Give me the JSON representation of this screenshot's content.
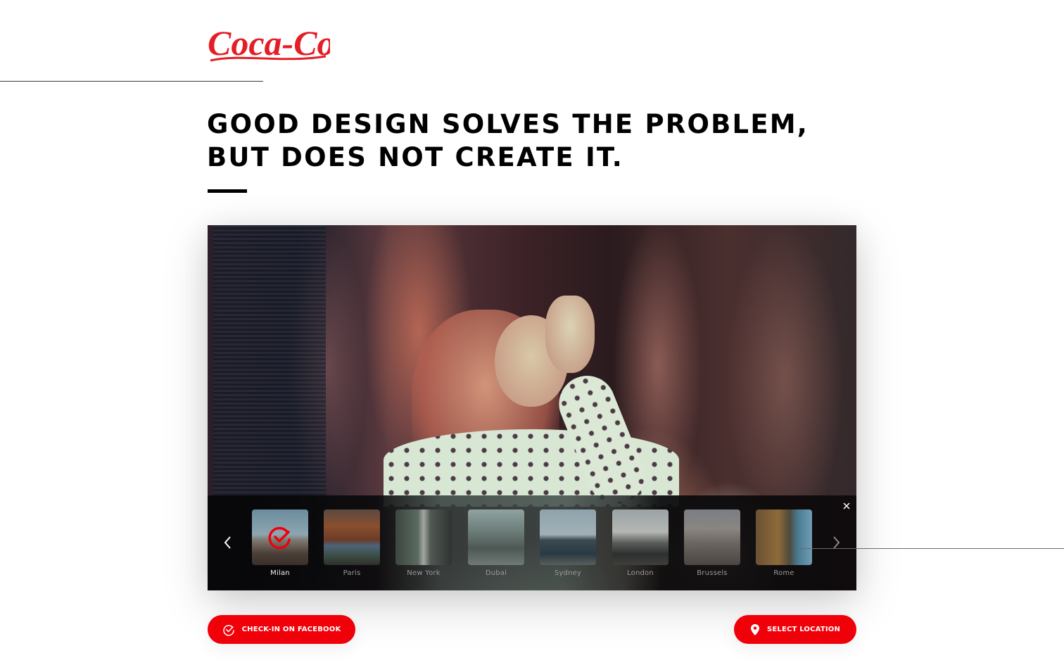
{
  "brand": {
    "logo_text": "Coca-Cola",
    "accent_color": "#f00009"
  },
  "headline": {
    "line1": "GOOD DESIGN SOLVES THE PROBLEM,",
    "line2": "BUT DOES NOT CREATE IT."
  },
  "carousel": {
    "prev_icon": "chevron-left-icon",
    "next_icon": "chevron-right-icon",
    "close_icon": "close-icon",
    "selected_index": 0,
    "locations": [
      {
        "label": "Milan",
        "selected": true
      },
      {
        "label": "Paris",
        "selected": false
      },
      {
        "label": "New York",
        "selected": false
      },
      {
        "label": "Dubai",
        "selected": false
      },
      {
        "label": "Sydney",
        "selected": false
      },
      {
        "label": "London",
        "selected": false
      },
      {
        "label": "Brussels",
        "selected": false
      },
      {
        "label": "Rome",
        "selected": false
      }
    ]
  },
  "actions": {
    "checkin_label": "CHECK-IN ON FACEBOOK",
    "checkin_icon": "check-circle-icon",
    "location_label": "SELECT LOCATION",
    "location_icon": "map-pin-icon"
  }
}
